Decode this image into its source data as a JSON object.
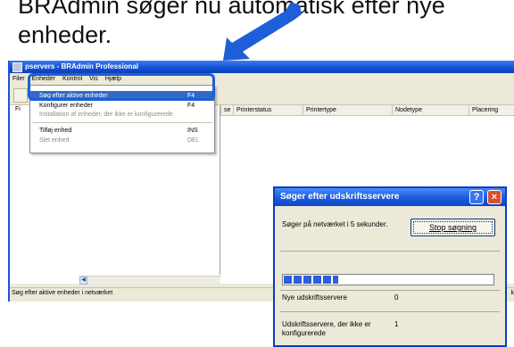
{
  "caption": {
    "line1": "BRAdmin søger nu automatisk efter nye",
    "line2": "enheder."
  },
  "main_window": {
    "title": "pservers - BRAdmin Professional",
    "menu": [
      "Filer",
      "Enheder",
      "Kontrol",
      "Vis",
      "Hjælp"
    ],
    "columns": [
      "se",
      "Printerstatus",
      "Printertype",
      "Nodetype",
      "Placering"
    ],
    "tree_label": "Fi",
    "status_text": "Søg efter aktive enheder i netværket",
    "status_suffix": "k"
  },
  "dropdown_menu": {
    "items": [
      {
        "label": "Søg efter aktive enheder",
        "shortcut": "F4"
      },
      {
        "label": "Konfigurer enheder",
        "shortcut": "F4"
      },
      {
        "label": "Installation af enheder, der ikke er konfigurerede",
        "shortcut": ""
      },
      {
        "label": "Tilføj enhed",
        "shortcut": "INS"
      },
      {
        "label": "Slet enhed",
        "shortcut": "DEL"
      }
    ]
  },
  "dialog": {
    "title": "Søger efter udskriftsservere",
    "search_text": "Søger på netværket i 5 sekunder.",
    "stop_button": "Stop søgning",
    "progress": 0.26,
    "new_label": "Nye udskriftsservere",
    "new_value": "0",
    "unconfigured_label": "Udskriftsservere, der ikke er konfigurerede",
    "unconfigured_value": "1",
    "help_glyph": "?",
    "close_glyph": "×"
  },
  "colors": {
    "accent": "#1d5fd8",
    "selection": "#316ac5",
    "titlebar": "#1250d4"
  }
}
